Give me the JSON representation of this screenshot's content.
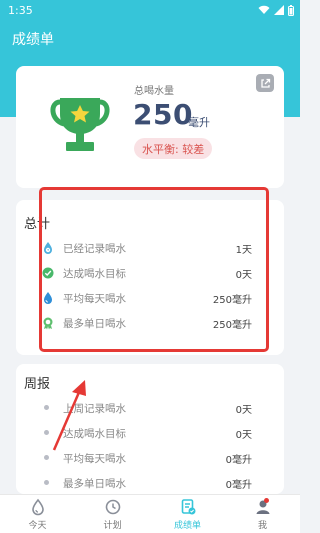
{
  "status_bar": {
    "time": "1:35"
  },
  "app_bar": {
    "title": "成绩单"
  },
  "summary": {
    "total_label": "总喝水量",
    "total_value": "250",
    "total_unit": "毫升",
    "balance": "水平衡: 较差"
  },
  "stats": {
    "title": "总计",
    "rows": [
      {
        "icon": "drop-clock-icon",
        "label": "已经记录喝水",
        "value": "1天"
      },
      {
        "icon": "target-check-icon",
        "label": "达成喝水目标",
        "value": "0天"
      },
      {
        "icon": "water-drop-icon",
        "label": "平均每天喝水",
        "value": "250毫升"
      },
      {
        "icon": "medal-icon",
        "label": "最多单日喝水",
        "value": "250毫升"
      }
    ]
  },
  "weekly": {
    "title": "周报",
    "rows": [
      {
        "label": "上周记录喝水",
        "value": "0天"
      },
      {
        "label": "达成喝水目标",
        "value": "0天"
      },
      {
        "label": "平均每天喝水",
        "value": "0毫升"
      },
      {
        "label": "最多单日喝水",
        "value": "0毫升"
      }
    ]
  },
  "nav": {
    "items": [
      {
        "label": "今天"
      },
      {
        "label": "计划"
      },
      {
        "label": "成绩单"
      },
      {
        "label": "我"
      }
    ],
    "active": 2
  },
  "colors": {
    "primary": "#36c5d9",
    "trophy": "#3aa85a",
    "star": "#f5d63d",
    "alert": "#e53935"
  }
}
